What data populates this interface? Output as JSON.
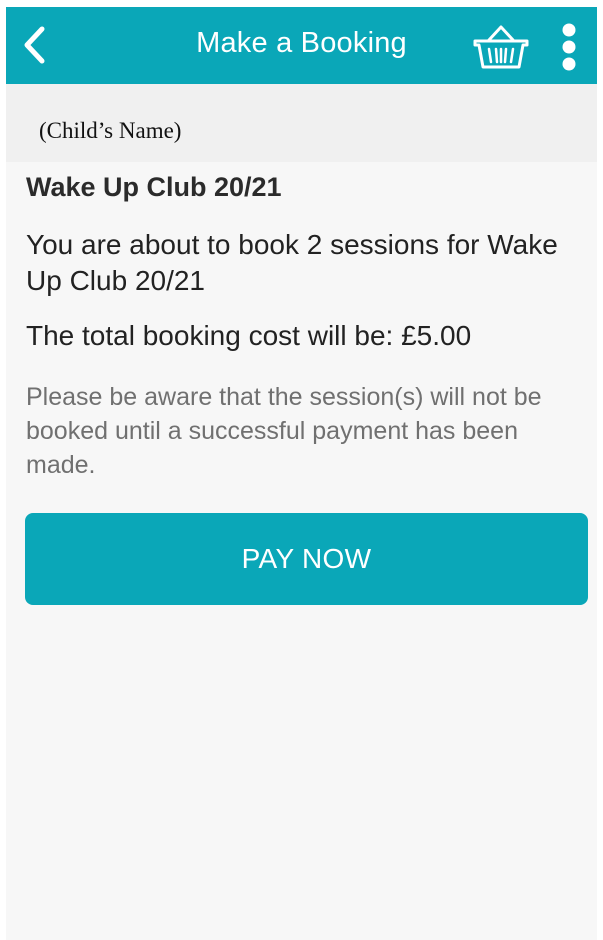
{
  "header": {
    "title": "Make a Booking",
    "back_icon": "chevron-left-icon",
    "basket_icon": "basket-icon",
    "more_icon": "more-vertical-icon",
    "bar_color": "#0aa7b8"
  },
  "child": {
    "name": "(Child’s Name)"
  },
  "booking": {
    "club_name": "Wake Up Club 20/21",
    "summary": "You are about to book 2 sessions for Wake Up Club 20/21",
    "total": "The total booking cost will be: £5.00",
    "notice": "Please be aware that the session(s) will not be booked until a successful payment has been made."
  },
  "actions": {
    "pay_label": "PAY NOW",
    "pay_color": "#0aa7b8"
  }
}
